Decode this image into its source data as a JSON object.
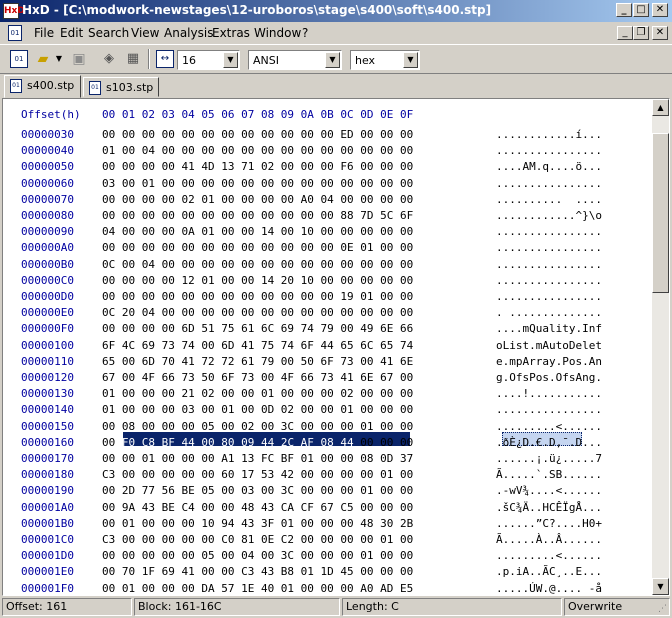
{
  "window": {
    "app_icon_text": "HxD",
    "title": "HxD - [C:\\modwork-newstages\\12-uroboros\\stage\\s400\\soft\\s400.stp]",
    "minimize_glyph": "_",
    "maximize_glyph": "□",
    "close_glyph": "✕"
  },
  "menu": {
    "items": [
      "File",
      "Edit",
      "Search",
      "View",
      "Analysis",
      "Extras",
      "Window",
      "?"
    ]
  },
  "toolbar": {
    "bytes_per_row": "16",
    "charset": "ANSI",
    "display_mode": "hex"
  },
  "tabs": [
    {
      "label": "s400.stp",
      "active": true
    },
    {
      "label": "s103.stp",
      "active": false
    }
  ],
  "editor": {
    "offset_header": "Offset(h)",
    "column_header": "00 01 02 03 04 05 06 07 08 09 0A 0B 0C 0D 0E 0F",
    "rows": [
      {
        "offset": "00000030",
        "hex": "00 00 00 00 00 00 00 00 00 00 00 00 ED 00 00 00",
        "ascii": "............í..."
      },
      {
        "offset": "00000040",
        "hex": "01 00 04 00 00 00 00 00 00 00 00 00 00 00 00 00",
        "ascii": "................"
      },
      {
        "offset": "00000050",
        "hex": "00 00 00 00 41 4D 13 71 02 00 00 00 F6 00 00 00",
        "ascii": "....AM.q....ö..."
      },
      {
        "offset": "00000060",
        "hex": "03 00 01 00 00 00 00 00 00 00 00 00 00 00 00 00",
        "ascii": "................"
      },
      {
        "offset": "00000070",
        "hex": "00 00 00 00 02 01 00 00 00 00 A0 04 00 00 00 00",
        "ascii": "..........  ...."
      },
      {
        "offset": "00000080",
        "hex": "00 00 00 00 00 00 00 00 00 00 00 00 88 7D 5C 6F",
        "ascii": "............^}\\o"
      },
      {
        "offset": "00000090",
        "hex": "04 00 00 00 0A 01 00 00 14 00 10 00 00 00 00 00",
        "ascii": "................"
      },
      {
        "offset": "000000A0",
        "hex": "00 00 00 00 00 00 00 00 00 00 00 00 0E 01 00 00",
        "ascii": "................"
      },
      {
        "offset": "000000B0",
        "hex": "0C 00 04 00 00 00 00 00 00 00 00 00 00 00 00 00",
        "ascii": "................"
      },
      {
        "offset": "000000C0",
        "hex": "00 00 00 00 12 01 00 00 14 20 10 00 00 00 00 00",
        "ascii": "................"
      },
      {
        "offset": "000000D0",
        "hex": "00 00 00 00 00 00 00 00 00 00 00 00 19 01 00 00",
        "ascii": "................"
      },
      {
        "offset": "000000E0",
        "hex": "0C 20 04 00 00 00 00 00 00 00 00 00 00 00 00 00",
        "ascii": ". .............."
      },
      {
        "offset": "000000F0",
        "hex": "00 00 00 00 6D 51 75 61 6C 69 74 79 00 49 6E 66",
        "ascii": "....mQuality.Inf"
      },
      {
        "offset": "00000100",
        "hex": "6F 4C 69 73 74 00 6D 41 75 74 6F 44 65 6C 65 74",
        "ascii": "oList.mAutoDelet"
      },
      {
        "offset": "00000110",
        "hex": "65 00 6D 70 41 72 72 61 79 00 50 6F 73 00 41 6E",
        "ascii": "e.mpArray.Pos.An"
      },
      {
        "offset": "00000120",
        "hex": "67 00 4F 66 73 50 6F 73 00 4F 66 73 41 6E 67 00",
        "ascii": "g.OfsPos.OfsAng."
      },
      {
        "offset": "00000130",
        "hex": "01 00 00 00 21 02 00 00 01 00 00 00 02 00 00 00",
        "ascii": "....!..........."
      },
      {
        "offset": "00000140",
        "hex": "01 00 00 00 03 00 01 00 0D 02 00 00 01 00 00 00",
        "ascii": "................"
      },
      {
        "offset": "00000150",
        "hex": "00 08 00 00 00 05 00 02 00 3C 00 00 00 01 00 00",
        "ascii": ".........<......"
      },
      {
        "offset": "00000160",
        "hex": "00 F0 C8 BF 44 00 80 09 44 2C AF 08 44 00 00 00",
        "ascii": ".ðÈ¿D.€.D,¯.D..."
      },
      {
        "offset": "00000170",
        "hex": "00 00 01 00 00 00 A1 13 FC BF 01 00 00 08 0D 37",
        "ascii": "......¡.ü¿.....7"
      },
      {
        "offset": "00000180",
        "hex": "C3 00 00 00 00 00 60 17 53 42 00 00 00 00 01 00",
        "ascii": "Ã.....`.SB......"
      },
      {
        "offset": "00000190",
        "hex": "00 2D 77 56 BE 05 00 03 00 3C 00 00 00 01 00 00",
        "ascii": ".-wV¾....<......"
      },
      {
        "offset": "000001A0",
        "hex": "00 9A 43 BE C4 00 00 48 43 CA CF 67 C5 00 00 00",
        "ascii": ".šC¾Ä..HCÊÏgÅ..."
      },
      {
        "offset": "000001B0",
        "hex": "00 01 00 00 00 10 94 43 3F 01 00 00 00 48 30 2B",
        "ascii": "......”C?....H0+"
      },
      {
        "offset": "000001C0",
        "hex": "C3 00 00 00 00 00 C0 81 0E C2 00 00 00 00 01 00",
        "ascii": "Ã.....À..Â......"
      },
      {
        "offset": "000001D0",
        "hex": "00 00 00 00 00 05 00 04 00 3C 00 00 00 01 00 00",
        "ascii": ".........<......"
      },
      {
        "offset": "000001E0",
        "hex": "00 70 1F 69 41 00 00 C3 43 B8 01 1D 45 00 00 00",
        "ascii": ".p.iA..ÃC¸..E..."
      },
      {
        "offset": "000001F0",
        "hex": "00 01 00 00 00 DA 57 1E 40 01 00 00 00 A0 AD E5",
        "ascii": ".....ÚW.@.... -å"
      }
    ]
  },
  "status": {
    "offset": "Offset: 161",
    "block": "Block: 161-16C",
    "length": "Length: C",
    "mode": "Overwrite"
  }
}
